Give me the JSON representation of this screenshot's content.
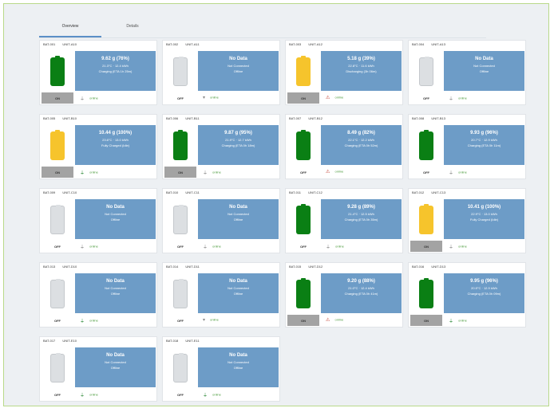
{
  "tabs": [
    "Overview",
    "Details"
  ],
  "status_label": "online",
  "colors": {
    "charging": "#0a7f14",
    "low": "#f6c42c",
    "empty": "#dcdfe2",
    "panel": "#6d9cc7"
  },
  "cards": [
    {
      "id": "BAT-001",
      "name": "UNIT-A10",
      "level": "9.62 g (76%)",
      "detail": "21.3°C · 12.4 kWh",
      "note": "Charging (ETA 1h 25m)",
      "button": "ON",
      "fill": "green",
      "icon": "plug-icon",
      "icon_color": "grey"
    },
    {
      "id": "BAT-002",
      "name": "UNIT-A11",
      "level": "No Data",
      "detail": "Not Connected",
      "note": "Offline",
      "button": "OFF",
      "fill": "empty",
      "icon": "signal-icon",
      "icon_color": "grey"
    },
    {
      "id": "BAT-003",
      "name": "UNIT-A12",
      "level": "5.18 g (39%)",
      "detail": "22.8°C · 11.6 kWh",
      "note": "Discharging (3h 06m)",
      "button": "ON",
      "fill": "yellow",
      "icon": "warning-icon",
      "icon_color": "red"
    },
    {
      "id": "BAT-004",
      "name": "UNIT-A13",
      "level": "No Data",
      "detail": "Not Connected",
      "note": "Offline",
      "button": "OFF",
      "fill": "empty",
      "icon": "plug-icon",
      "icon_color": "grey"
    },
    {
      "id": "BAT-005",
      "name": "UNIT-B10",
      "level": "10.44 g (100%)",
      "detail": "23.6°C · 13.0 kWh",
      "note": "Fully Charged (Idle)",
      "button": "ON",
      "fill": "yellow",
      "icon": "plug-icon",
      "icon_color": "green"
    },
    {
      "id": "BAT-006",
      "name": "UNIT-B11",
      "level": "9.87 g (95%)",
      "detail": "21.9°C · 12.7 kWh",
      "note": "Charging (ETA 0h 18m)",
      "button": "ON",
      "fill": "green",
      "icon": "plug-icon",
      "icon_color": "grey"
    },
    {
      "id": "BAT-007",
      "name": "UNIT-B12",
      "level": "8.49 g (82%)",
      "detail": "22.1°C · 12.2 kWh",
      "note": "Charging (ETA 0h 52m)",
      "button": "OFF",
      "fill": "green",
      "icon": "warning-icon",
      "icon_color": "red"
    },
    {
      "id": "BAT-008",
      "name": "UNIT-B13",
      "level": "9.93 g (96%)",
      "detail": "20.7°C · 12.9 kWh",
      "note": "Charging (ETA 0h 11m)",
      "button": "OFF",
      "fill": "green",
      "icon": "plug-icon",
      "icon_color": "grey"
    },
    {
      "id": "BAT-009",
      "name": "UNIT-C10",
      "level": "No Data",
      "detail": "Not Connected",
      "note": "Offline",
      "button": "OFF",
      "fill": "empty",
      "icon": "plug-icon",
      "icon_color": "grey"
    },
    {
      "id": "BAT-010",
      "name": "UNIT-C11",
      "level": "No Data",
      "detail": "Not Connected",
      "note": "Offline",
      "button": "OFF",
      "fill": "empty",
      "icon": "plug-icon",
      "icon_color": "grey"
    },
    {
      "id": "BAT-011",
      "name": "UNIT-C12",
      "level": "9.28 g (89%)",
      "detail": "21.4°C · 12.5 kWh",
      "note": "Charging (ETA 0h 35m)",
      "button": "OFF",
      "fill": "green",
      "icon": "plug-icon",
      "icon_color": "grey"
    },
    {
      "id": "BAT-012",
      "name": "UNIT-C13",
      "level": "10.41 g (100%)",
      "detail": "22.9°C · 13.0 kWh",
      "note": "Fully Charged (Idle)",
      "button": "ON",
      "fill": "yellow",
      "icon": "plug-icon",
      "icon_color": "grey"
    },
    {
      "id": "BAT-013",
      "name": "UNIT-D10",
      "level": "No Data",
      "detail": "Not Connected",
      "note": "Offline",
      "button": "OFF",
      "fill": "empty",
      "icon": "plug-icon",
      "icon_color": "green"
    },
    {
      "id": "BAT-014",
      "name": "UNIT-D11",
      "level": "No Data",
      "detail": "Not Connected",
      "note": "Offline",
      "button": "OFF",
      "fill": "empty",
      "icon": "signal-icon",
      "icon_color": "grey"
    },
    {
      "id": "BAT-015",
      "name": "UNIT-D12",
      "level": "9.20 g (88%)",
      "detail": "21.0°C · 12.4 kWh",
      "note": "Charging (ETA 0h 41m)",
      "button": "ON",
      "fill": "green",
      "icon": "warning-icon",
      "icon_color": "red"
    },
    {
      "id": "BAT-016",
      "name": "UNIT-D13",
      "level": "9.95 g (96%)",
      "detail": "20.5°C · 12.9 kWh",
      "note": "Charging (ETA 0h 09m)",
      "button": "ON",
      "fill": "green",
      "icon": "plug-icon",
      "icon_color": "green"
    },
    {
      "id": "BAT-017",
      "name": "UNIT-E10",
      "level": "No Data",
      "detail": "Not Connected",
      "note": "Offline",
      "button": "OFF",
      "fill": "empty",
      "icon": "plug-icon",
      "icon_color": "green"
    },
    {
      "id": "BAT-018",
      "name": "UNIT-E11",
      "level": "No Data",
      "detail": "Not Connected",
      "note": "Offline",
      "button": "OFF",
      "fill": "empty",
      "icon": "plug-icon",
      "icon_color": "green"
    }
  ]
}
